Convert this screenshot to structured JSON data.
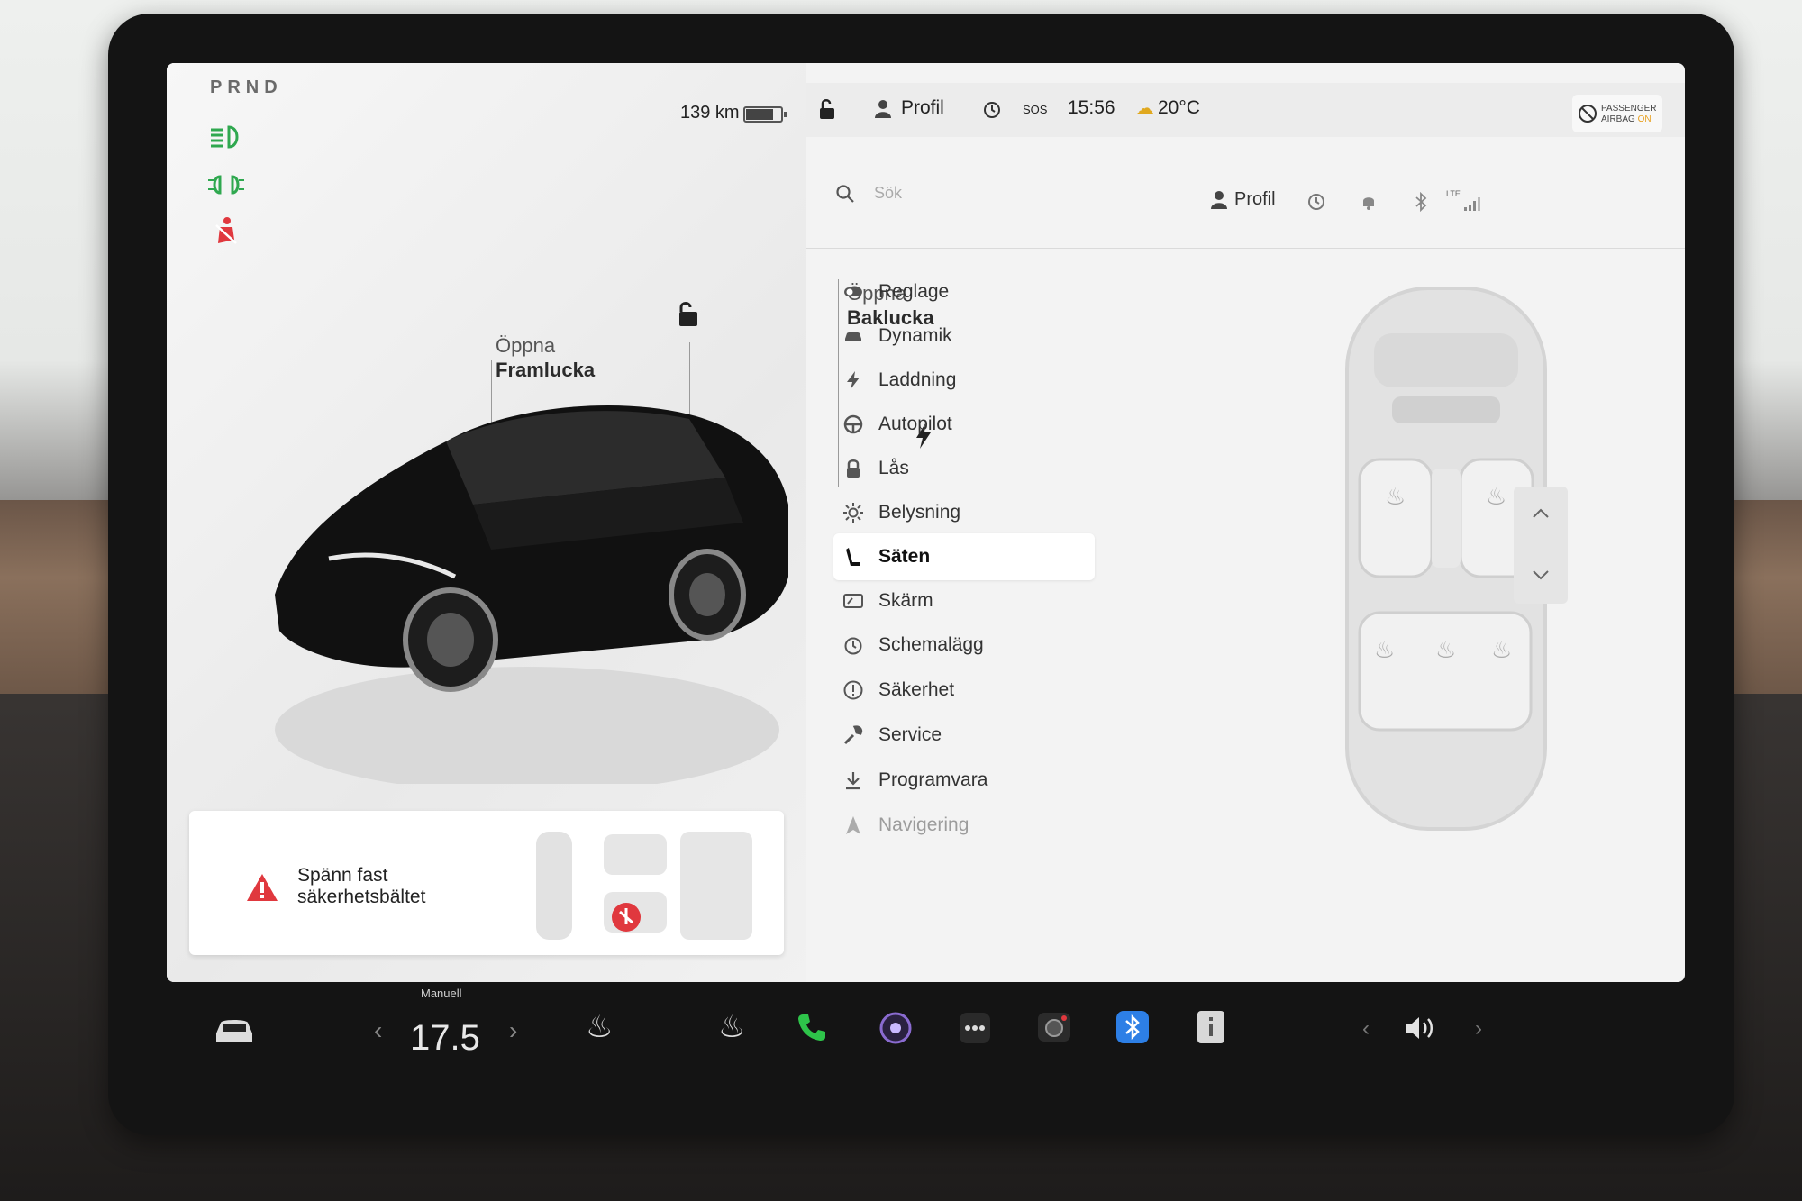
{
  "gear": "PRND",
  "range": "139 km",
  "car_view": {
    "frunk_line1": "Öppna",
    "frunk_line2": "Framlucka",
    "trunk_line1": "Öppna",
    "trunk_line2": "Baklucka"
  },
  "alert": {
    "line1": "Spänn fast",
    "line2": "säkerhetsbältet"
  },
  "status_bar": {
    "profile": "Profil",
    "sos": "SOS",
    "time": "15:56",
    "temperature": "20°C",
    "airbag_line1": "PASSENGER",
    "airbag_line2": "AIRBAG",
    "airbag_state": "ON"
  },
  "settings": {
    "search_placeholder": "Sök",
    "profile": "Profil",
    "lte": "LTE",
    "menu": [
      {
        "label": "Reglage",
        "icon": "toggle-icon"
      },
      {
        "label": "Dynamik",
        "icon": "car-icon"
      },
      {
        "label": "Laddning",
        "icon": "bolt-icon"
      },
      {
        "label": "Autopilot",
        "icon": "steering-wheel-icon"
      },
      {
        "label": "Lås",
        "icon": "lock-icon"
      },
      {
        "label": "Belysning",
        "icon": "sun-icon"
      },
      {
        "label": "Säten",
        "icon": "seat-icon",
        "selected": true
      },
      {
        "label": "Skärm",
        "icon": "display-icon"
      },
      {
        "label": "Schemalägg",
        "icon": "clock-icon"
      },
      {
        "label": "Säkerhet",
        "icon": "alert-circle-icon"
      },
      {
        "label": "Service",
        "icon": "wrench-icon"
      },
      {
        "label": "Programvara",
        "icon": "download-icon"
      },
      {
        "label": "Navigering",
        "icon": "navigation-icon"
      }
    ]
  },
  "dock": {
    "climate_mode": "Manuell",
    "temperature": "17.5"
  }
}
